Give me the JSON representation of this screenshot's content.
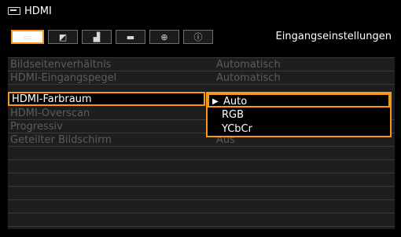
{
  "header": {
    "title": "HDMI",
    "source_icon": "hdmi-source-icon"
  },
  "tabs": [
    {
      "icon": "input-icon",
      "glyph": "▭",
      "active": true
    },
    {
      "icon": "picture-icon",
      "glyph": "◩",
      "active": false
    },
    {
      "icon": "install-icon",
      "glyph": "▟",
      "active": false
    },
    {
      "icon": "settings-icon",
      "glyph": "▬",
      "active": false
    },
    {
      "icon": "network-icon",
      "glyph": "⊕",
      "active": false
    },
    {
      "icon": "info-icon",
      "glyph": "ⓘ",
      "active": false
    }
  ],
  "section_title": "Eingangseinstellungen",
  "menu": {
    "rows": [
      {
        "label": "Bildseitenverhältnis",
        "value": "Automatisch"
      },
      {
        "label": "HDMI-Eingangspegel",
        "value": "Automatisch"
      },
      {
        "label": "HDMI-Farbraum",
        "value": ""
      },
      {
        "label": "HDMI-Overscan",
        "value": ""
      },
      {
        "label": "Progressiv",
        "value": ""
      },
      {
        "label": "Geteilter Bildschirm",
        "value": "Aus"
      },
      {
        "label": "",
        "value": ""
      },
      {
        "label": "",
        "value": ""
      },
      {
        "label": "",
        "value": ""
      },
      {
        "label": "",
        "value": ""
      },
      {
        "label": "",
        "value": ""
      },
      {
        "label": "",
        "value": ""
      }
    ],
    "selected_index": 2
  },
  "dropdown": {
    "options": [
      "Auto",
      "RGB",
      "YCbCr"
    ],
    "selected_index": 0,
    "caret": "▶"
  },
  "colors": {
    "accent": "#f39a1e",
    "background": "#000000",
    "row_bg": "#1e1e1e",
    "disabled_text": "#5c5c5c",
    "text": "#ffffff"
  }
}
